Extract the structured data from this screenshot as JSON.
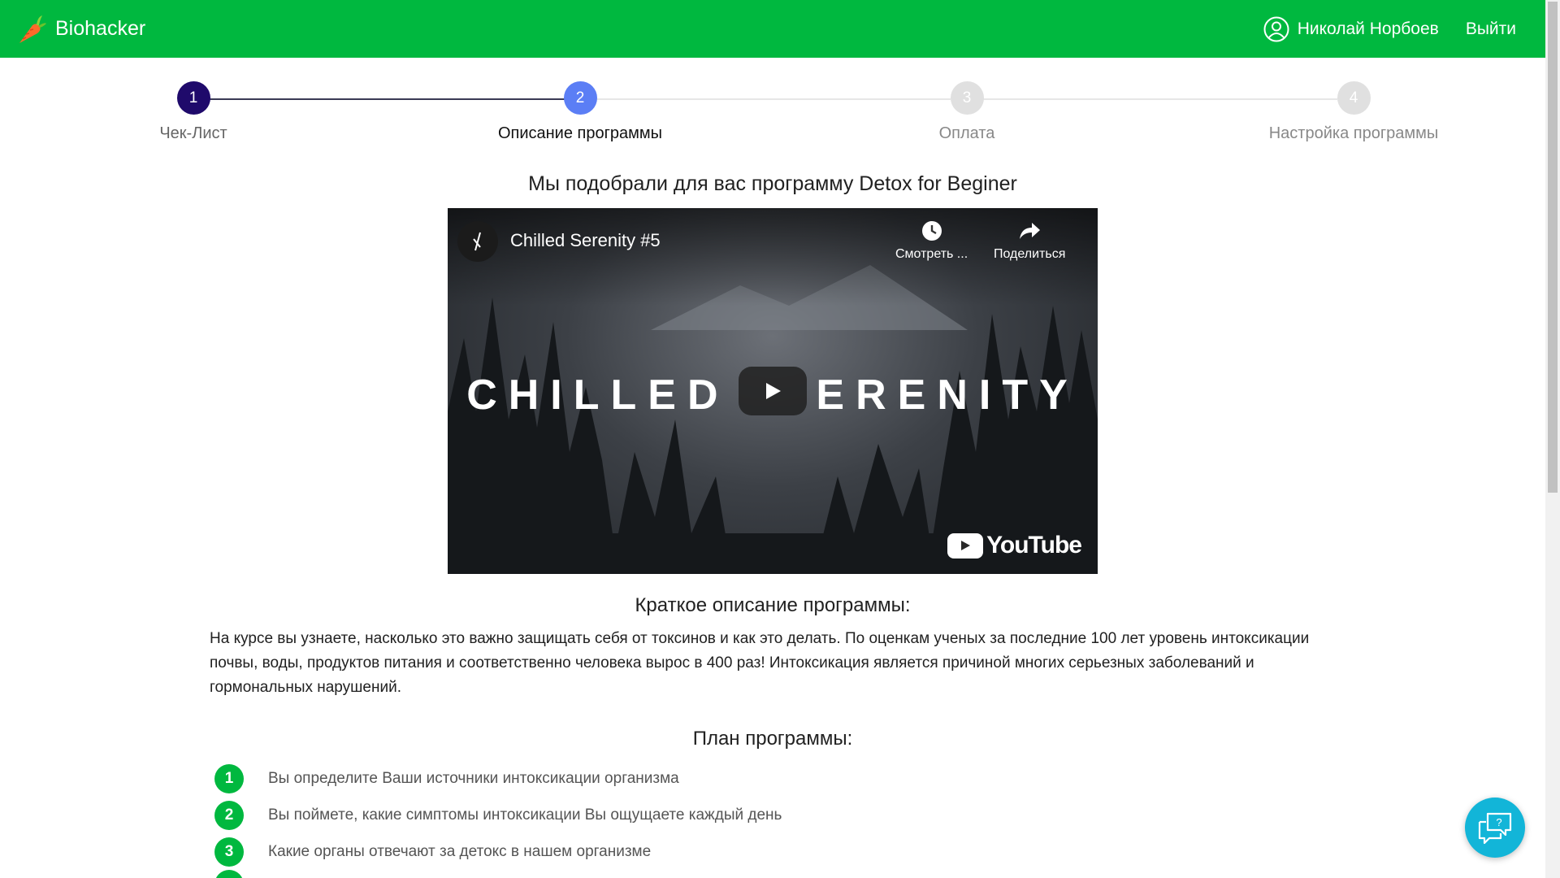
{
  "header": {
    "brand": "Biohacker",
    "user_name": "Николай Норбоев",
    "logout_label": "Выйти",
    "accent_color": "#00b83f"
  },
  "stepper": {
    "steps": [
      {
        "number": "1",
        "label": "Чек-Лист",
        "state": "completed",
        "color": "#1f0a6b"
      },
      {
        "number": "2",
        "label": "Описание программы",
        "state": "active",
        "color": "#5b7ef5"
      },
      {
        "number": "3",
        "label": "Оплата",
        "state": "inactive",
        "color": "#e0e0e0"
      },
      {
        "number": "4",
        "label": "Настройка программы",
        "state": "inactive",
        "color": "#e0e0e0"
      }
    ]
  },
  "main": {
    "title": "Мы подобрали для вас программу Detox for Beginer",
    "video": {
      "title": "Chilled Serenity #5",
      "overlay_text_left": "CHILLED",
      "overlay_text_right": "ERENITY",
      "watch_later_label": "Смотреть ...",
      "share_label": "Поделиться",
      "provider": "YouTube"
    },
    "summary_title": "Краткое описание программы:",
    "summary_text": "На курсе вы узнаете, насколько это важно защищать себя от токсинов и как это делать. По оценкам ученых за последние 100 лет уровень интоксикации почвы, воды, продуктов питания и соответственно человека вырос в 400 раз! Интоксикация является причиной многих серьезных заболеваний и гормональных нарушений.",
    "plan_title": "План программы:",
    "plan_items": [
      {
        "number": "1",
        "text": "Вы определите Ваши источники интоксикации организма"
      },
      {
        "number": "2",
        "text": "Вы поймете, какие симптомы интоксикации Вы ощущаете каждый день"
      },
      {
        "number": "3",
        "text": "Какие органы отвечают за детокс в нашем организме"
      }
    ]
  },
  "icons": {
    "logo": "carrot-icon",
    "user": "user-circle-icon",
    "chat": "chat-help-icon"
  }
}
